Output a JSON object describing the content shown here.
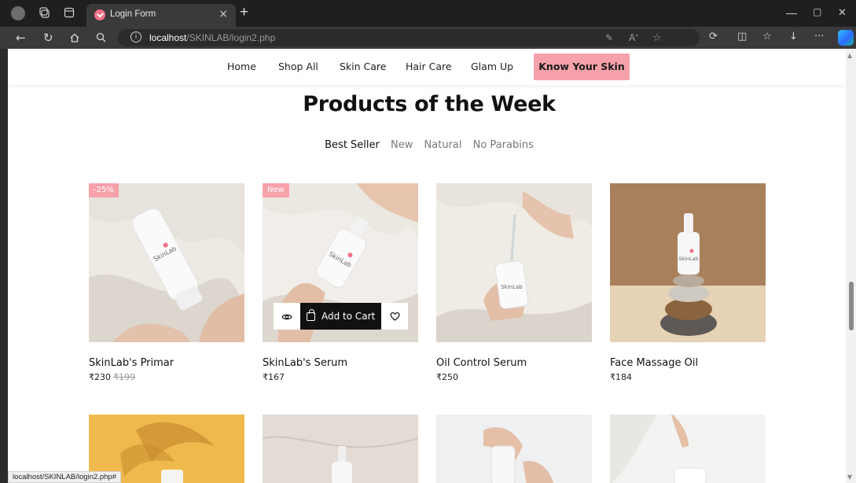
{
  "browser": {
    "tab_title": "Login Form",
    "tab_close": "×",
    "new_tab": "+",
    "url_host": "localhost",
    "url_path": "/SKINLAB/login2.php",
    "status_url": "localhost/SKINLAB/login2.php#",
    "window_minimize": "—",
    "window_maximize": "▢",
    "window_close": "✕"
  },
  "nav": {
    "items": [
      "Home",
      "Shop All",
      "Skin Care",
      "Hair Care",
      "Glam Up"
    ],
    "cta": "Know Your Skin"
  },
  "section": {
    "title": "Products of the Week",
    "filters": [
      "Best Seller",
      "New",
      "Natural",
      "No Parabins"
    ],
    "active_filter": "Best Seller"
  },
  "products": [
    {
      "name": "SkinLab's Primar",
      "price": "₹230",
      "old_price": "₹199",
      "badge": "-25%"
    },
    {
      "name": "SkinLab's Serum",
      "price": "₹167",
      "badge": "New"
    },
    {
      "name": "Oil Control Serum",
      "price": "₹250"
    },
    {
      "name": "Face Massage Oil",
      "price": "₹184"
    }
  ],
  "product_actions": {
    "quick_view_icon": "eye-icon",
    "add_to_cart": "Add to Cart",
    "wishlist_icon": "heart-icon"
  },
  "colors": {
    "accent_pink": "#f7a1ab",
    "dark": "#111111"
  }
}
